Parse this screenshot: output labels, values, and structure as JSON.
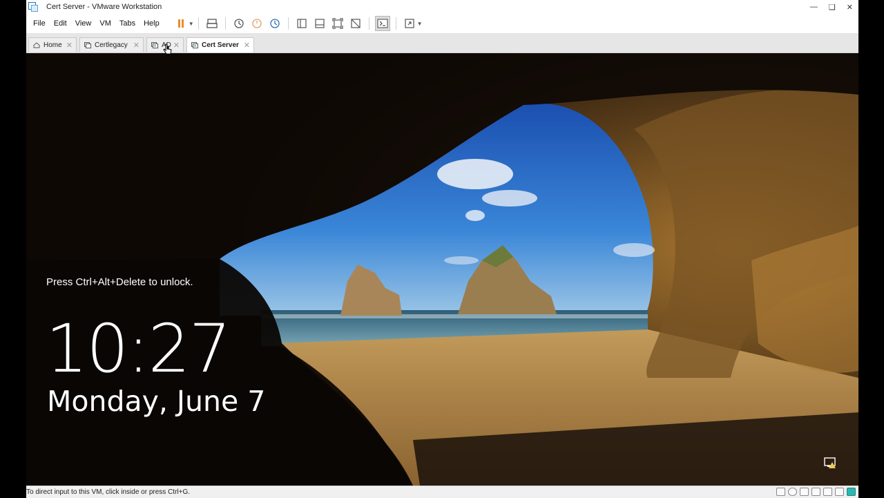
{
  "window": {
    "title": "Cert Server - VMware Workstation"
  },
  "menu": [
    {
      "label": "File"
    },
    {
      "label": "Edit"
    },
    {
      "label": "View"
    },
    {
      "label": "VM"
    },
    {
      "label": "Tabs"
    },
    {
      "label": "Help"
    }
  ],
  "tabs": [
    {
      "label": "Home",
      "icon": "home-icon",
      "active": false
    },
    {
      "label": "Certlegacy",
      "icon": "vm-icon",
      "active": false
    },
    {
      "label": "AD",
      "icon": "vm-running-icon",
      "active": false
    },
    {
      "label": "Cert Server",
      "icon": "vm-running-icon",
      "active": true
    }
  ],
  "lockscreen": {
    "prompt": "Press Ctrl+Alt+Delete to unlock.",
    "time": "10:27",
    "date": "Monday, June 7"
  },
  "status": {
    "text": "To direct input to this VM, click inside or press Ctrl+G."
  },
  "colors": {
    "accent": "#e98b2a",
    "sky": "#2a6fd0",
    "sand": "#b88a45"
  }
}
